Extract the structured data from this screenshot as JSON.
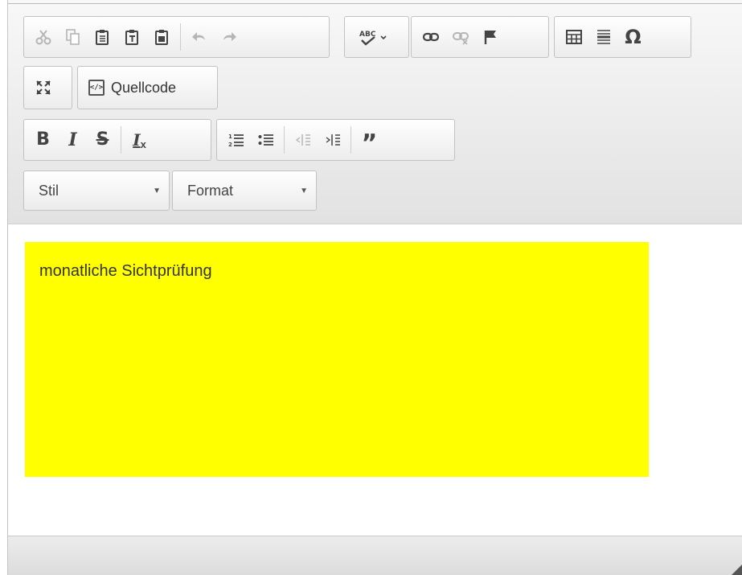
{
  "toolbar": {
    "source_label": "Quellcode",
    "style_combo": "Stil",
    "format_combo": "Format"
  },
  "content": {
    "text": "monatliche Sichtprüfung",
    "highlight_color": "#ffff00"
  },
  "icons": {
    "cut": "cut-icon",
    "copy": "copy-icon",
    "paste": "paste-icon",
    "paste_text": "paste-text-icon",
    "paste_word": "paste-word-icon",
    "undo": "undo-icon",
    "redo": "redo-icon",
    "spellcheck": "spellcheck-icon",
    "link": "link-icon",
    "unlink": "unlink-icon",
    "anchor": "anchor-icon",
    "table": "table-icon",
    "hr": "horizontal-line-icon",
    "special_char": "omega-icon",
    "maximize": "maximize-icon",
    "bold": "bold-icon",
    "italic": "italic-icon",
    "strike": "strikethrough-icon",
    "remove_format": "remove-format-icon",
    "ol": "numbered-list-icon",
    "ul": "bulleted-list-icon",
    "outdent": "outdent-icon",
    "indent": "indent-icon",
    "blockquote": "blockquote-icon"
  }
}
